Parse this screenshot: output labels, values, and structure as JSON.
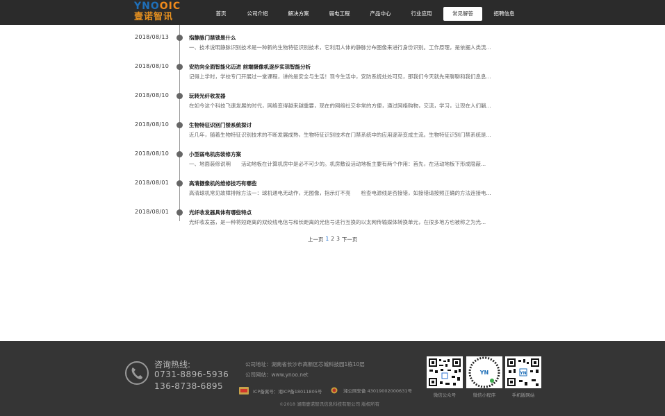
{
  "header": {
    "logo_text_1": "YNO",
    "logo_text_2": "OIC",
    "logo_text_cn": "壹诺智讯",
    "nav": [
      {
        "label": "首页",
        "active": false
      },
      {
        "label": "公司介绍",
        "active": false
      },
      {
        "label": "解决方案",
        "active": false
      },
      {
        "label": "弱电工程",
        "active": false
      },
      {
        "label": "产品中心",
        "active": false
      },
      {
        "label": "行业应用",
        "active": false
      },
      {
        "label": "常见解答",
        "active": true
      },
      {
        "label": "招聘信息",
        "active": false
      }
    ]
  },
  "articles": [
    {
      "date": "2018/08/13",
      "title": "指静脉门禁锁是什么",
      "summary": "一、技术说明静脉识别技术是一种新的生物特征识别技术，它利用人体的静脉分布图像来进行身份识别。工作原理，是依据人类流..."
    },
    {
      "date": "2018/08/10",
      "title": "安防向全面智能化迈进 前端摄像机逐步实现智能分析",
      "summary": "记得上学时，学校专门开展过一堂课程，讲的是安全与生活！现今生活中，安防系统处处可见，那我们今天就先来聊聊和我们息息..."
    },
    {
      "date": "2018/08/10",
      "title": "玩转光纤收发器",
      "summary": "在如今这个科技飞速发展的时代，网络变得越来越重要，现在的网络社交非常的方便，通过网络购物，交流，学习，让现在人们躺..."
    },
    {
      "date": "2018/08/10",
      "title": "生物特征识别门禁系统探讨",
      "summary": "近几年，随着生物特征识别技术的不断发展成熟，生物特征识别技术在门禁系统中的应用逐渐变成主流。生物特征识别门禁系统是..."
    },
    {
      "date": "2018/08/10",
      "title": "小型弱电机房装修方案",
      "summary": "一、地面装修说明　　活动地板在计算机房中是必不可少的。机房敷设活动地板主要有两个作用：首先，在活动地板下形成隐蔽..."
    },
    {
      "date": "2018/08/01",
      "title": "高清摄像机的维修技巧有哪些",
      "summary": "高清球机常见故障排除方法一：球机通电无动作，无图像，指示灯不亮　　检查电源线是否接错，如接错请按照正确的方法连接电..."
    },
    {
      "date": "2018/08/01",
      "title": "光纤收发器具体有哪些特点",
      "summary": "光纤收发器，是一种将短距离的双绞线电信号和长距离的光信号进行互换的以太网传输媒体转换单元，在很多地方也被称之为光..."
    }
  ],
  "pagination": {
    "prev": "上一页",
    "pages": [
      "1",
      "2",
      "3"
    ],
    "current": "1",
    "next": "下一页"
  },
  "footer": {
    "hotline_label": "咨询热线:",
    "phone_1": "0731-8896-5936",
    "phone_2": "136-8738-6895",
    "address": "公司地址：湖南省长沙市高新区芯城科技园1栋10层",
    "website": "公司网站：www.ynoo.net",
    "icp": "ICP备案号：湘ICP备18011805号",
    "security": "湘公网安备 43019002000631号",
    "copyright": "©2018 湖南壹诺智讯信息科技有限公司 版权所有",
    "qr_codes": [
      {
        "label": "微信公众号"
      },
      {
        "label": "微信小程序"
      },
      {
        "label": "手机版网站"
      }
    ]
  },
  "colors": {
    "header_bg": "#2b2b2b",
    "footer_bg": "#353535",
    "logo_blue": "#1f6fb8",
    "logo_orange": "#f08a1c",
    "page_current": "#1e6fd0"
  }
}
